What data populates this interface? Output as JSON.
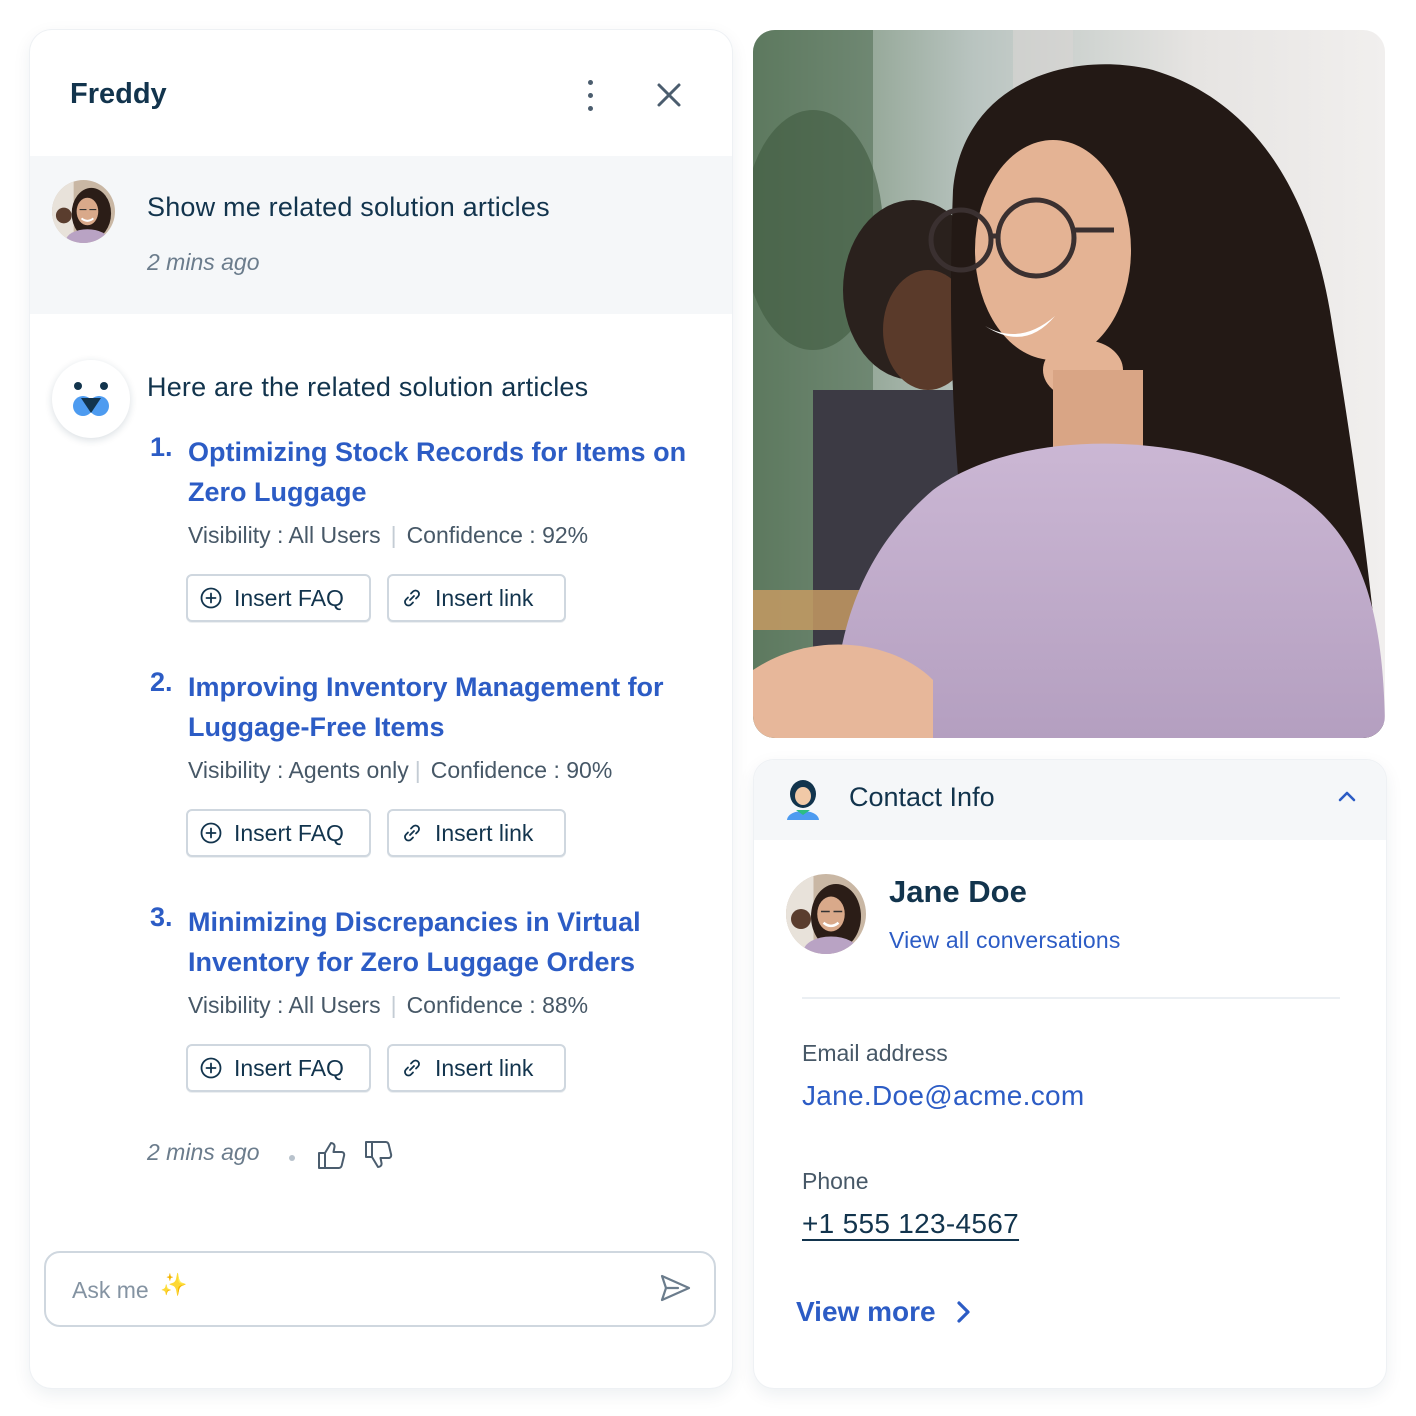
{
  "chat": {
    "title": "Freddy",
    "user_message": "Show me related solution articles",
    "user_time": "2 mins ago",
    "bot_intro": "Here are the related solution articles",
    "articles": [
      {
        "number": "1.",
        "title": "Optimizing Stock Records for Items on Zero Luggage",
        "visibility": "Visibility : All Users",
        "confidence": "Confidence : 92%",
        "faq_label": "Insert FAQ",
        "link_label": "Insert link"
      },
      {
        "number": "2.",
        "title": "Improving Inventory Management for Luggage-Free Items",
        "visibility": "Visibility : Agents only",
        "confidence": "Confidence : 90%",
        "faq_label": "Insert FAQ",
        "link_label": "Insert link"
      },
      {
        "number": "3.",
        "title": "Minimizing Discrepancies in Virtual Inventory for Zero Luggage Orders",
        "visibility": "Visibility : All Users",
        "confidence": "Confidence : 88%",
        "faq_label": "Insert FAQ",
        "link_label": "Insert link"
      }
    ],
    "bot_time": "2 mins ago",
    "input_placeholder": "Ask me",
    "sparkle": "✨",
    "icons": [
      "kebab-menu-icon",
      "close-icon",
      "plus-circle-icon",
      "link-icon",
      "thumbs-up-icon",
      "thumbs-down-icon",
      "send-icon",
      "freddy-bot-icon"
    ]
  },
  "contact": {
    "section_title": "Contact Info",
    "name": "Jane Doe",
    "view_conversations": "View all conversations",
    "email_label": "Email address",
    "email": "Jane.Doe@acme.com",
    "phone_label": "Phone",
    "phone": "+1 555 123-4567",
    "view_more": "View more",
    "icons": [
      "contact-person-icon",
      "chevron-up-icon",
      "chevron-right-icon"
    ]
  },
  "colors": {
    "brand_blue": "#2c5cc5",
    "text_dark": "#12344d",
    "text_muted": "#475867",
    "panel_bg": "#f5f7f9",
    "border": "#cfd7df"
  }
}
